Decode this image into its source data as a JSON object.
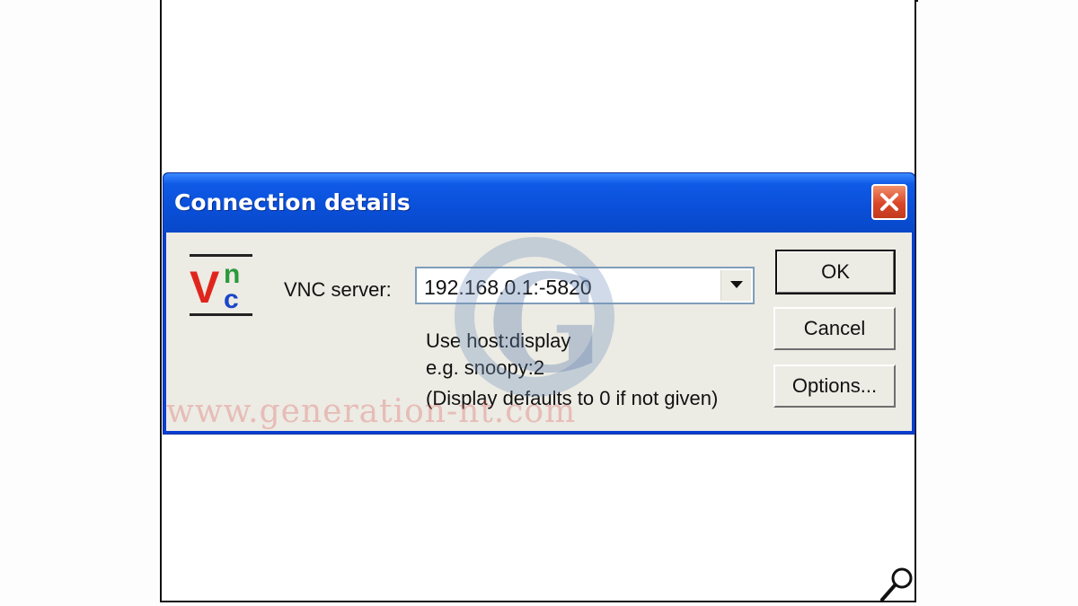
{
  "dialog": {
    "title": "Connection details",
    "server_label": "VNC server:",
    "server_value": "192.168.0.1:-5820",
    "hint_line1": "Use host:display",
    "hint_line2": "e.g. snoopy:2",
    "hint_line3": "(Display defaults to 0 if not given)",
    "buttons": {
      "ok": "OK",
      "cancel": "Cancel",
      "options": "Options..."
    }
  },
  "logo": {
    "letter_v": "V",
    "letter_n": "n",
    "letter_c": "c"
  },
  "watermark": {
    "text": "www.generation-nt.com",
    "letter": "G"
  },
  "icons": {
    "close": "close-icon",
    "dropdown": "chevron-down-icon",
    "magnifier": "magnifier-icon"
  },
  "colors": {
    "titlebar": "#0a4fd8",
    "client_bg": "#ecebe4",
    "close_button": "#d9462a",
    "logo_red": "#e0261c",
    "logo_green": "#2a9a3a",
    "logo_blue": "#1b46c8"
  }
}
